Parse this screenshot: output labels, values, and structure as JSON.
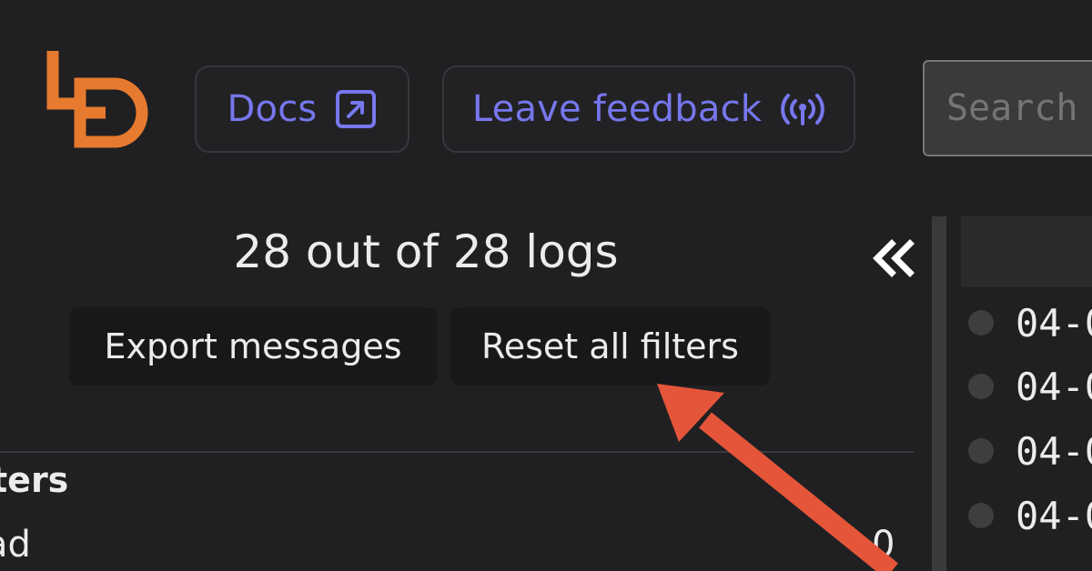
{
  "header": {
    "docs_label": "Docs",
    "feedback_label": "Leave feedback",
    "search_placeholder": "Search",
    "icons": {
      "logo": "ld-logo",
      "docs": "external-link-icon",
      "feedback": "broadcast-icon"
    }
  },
  "logs": {
    "count_text": "28 out of 28 logs",
    "export_label": "Export messages",
    "reset_label": "Reset all filters",
    "collapse_icon": "double-chevron-left-icon"
  },
  "filters": {
    "title": "ters",
    "rows": [
      {
        "label": "ad",
        "count": "0"
      }
    ]
  },
  "entries": [
    {
      "text": "04-0"
    },
    {
      "text": "04-0"
    },
    {
      "text": "04-0"
    },
    {
      "text": "04-0"
    }
  ],
  "colors": {
    "background": "#202022",
    "accent": "#7777ee",
    "logo": "#e67a2e",
    "annotation": "#e5553a"
  }
}
